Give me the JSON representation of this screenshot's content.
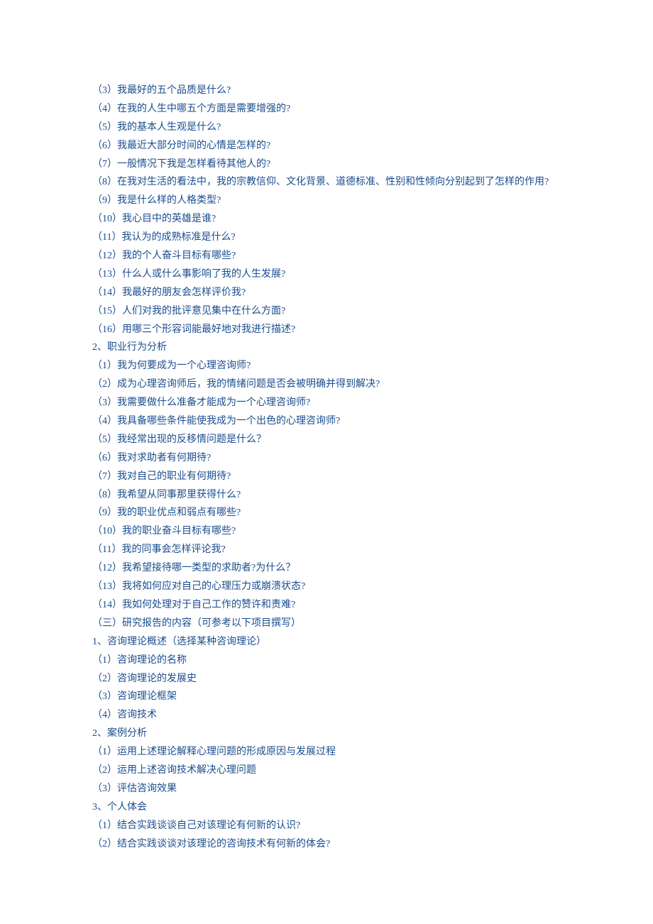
{
  "lines": [
    "（3）我最好的五个品质是什么?",
    "（4）在我的人生中哪五个方面是需要增强的?",
    "（5）我的基本人生观是什么?",
    "（6）我最近大部分时间的心情是怎样的?",
    "（7）一般情况下我是怎样看待其他人的?",
    "（8）在我对生活的看法中，我的宗教信仰、文化背景、道德标准、性别和性倾向分别起到了怎样的作用?",
    "（9）我是什么样的人格类型?",
    "（10）我心目中的英雄是谁?",
    "（11）我认为的成熟标准是什么?",
    "（12）我的个人奋斗目标有哪些?",
    "（13）什么人或什么事影响了我的人生发展?",
    "（14）我最好的朋友会怎样评价我?",
    "（15）人们对我的批评意见集中在什么方面?",
    "（16）用哪三个形容词能最好地对我进行描述?",
    "2、职业行为分析",
    "（1）我为何要成为一个心理咨询师?",
    "（2）成为心理咨询师后，我的情绪问题是否会被明确并得到解决?",
    "（3）我需要做什么准备才能成为一个心理咨询师?",
    "（4）我具备哪些条件能使我成为一个出色的心理咨询师?",
    "（5）我经常出现的反移情问题是什么？",
    "（6）我对求助者有何期待?",
    "（7）我对自己的职业有何期待?",
    "（8）我希望从同事那里获得什么?",
    "（9）我的职业优点和弱点有哪些?",
    "（10）我的职业奋斗目标有哪些?",
    "（11）我的同事会怎样评论我?",
    "（12）我希望接待哪一类型的求助者?为什么？",
    "（13）我将如何应对自己的心理压力或崩溃状态?",
    "（14）我如何处理对于自己工作的赞许和责难?",
    "（三）研究报告的内容（可参考以下项目撰写）",
    "1、咨询理论概述（选择某种咨询理论）",
    "（1）咨询理论的名称",
    "（2）咨询理论的发展史",
    "（3）咨询理论框架",
    "（4）咨询技术",
    "2、案例分析",
    "（1）运用上述理论解释心理问题的形成原因与发展过程",
    "（2）运用上述咨询技术解决心理问题",
    "（3）评估咨询效果",
    "3、个人体会",
    "（1）结合实践谈谈自己对该理论有何新的认识?",
    "（2）结合实践谈谈对该理论的咨询技术有何新的体会?"
  ]
}
